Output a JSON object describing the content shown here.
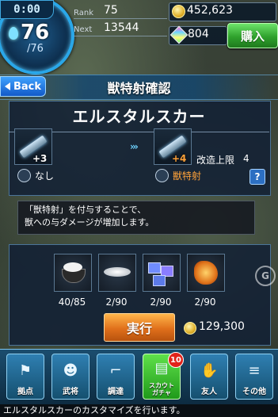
{
  "hud": {
    "timer": "0:00",
    "stamina_current": "76",
    "stamina_max": "/76",
    "rank_label": "Rank",
    "rank_value": "75",
    "next_label": "Next",
    "next_value": "13544",
    "coins": "452,623",
    "gems": "804",
    "buy_label": "購入"
  },
  "header": {
    "back_label": "Back",
    "title": "獣特射確認"
  },
  "weapon": {
    "name": "エルスタルスカー",
    "before_plus": "+3",
    "after_plus": "+4",
    "before_skill": "なし",
    "after_skill": "獣特射",
    "upgrade_limit_label": "改造上限",
    "upgrade_limit_value": "4",
    "help_label": "?"
  },
  "description": {
    "line1": "「獣特射」を付与することで、",
    "line2": "獣への与ダメージが増加します。"
  },
  "materials": [
    {
      "name": "white-powder-bowl",
      "count": "40/85"
    },
    {
      "name": "silver-disc",
      "count": "2/90"
    },
    {
      "name": "blue-cubes",
      "count": "2/90"
    },
    {
      "name": "orange-crystal-coral",
      "count": "2/90"
    }
  ],
  "action": {
    "execute_label": "実行",
    "cost": "129,300"
  },
  "nav": {
    "base": "拠点",
    "generals": "武将",
    "procure": "調達",
    "gacha_line1": "スカウト",
    "gacha_line2": "ガチャ",
    "gacha_badge": "10",
    "friends": "友人",
    "other": "その他"
  },
  "status": "エルスタルスカーのカスタマイズを行います。",
  "watermark": "G",
  "colors": {
    "accent_blue": "#2aa7e8",
    "buy_green": "#2fa12c",
    "execute_orange": "#e0701b",
    "skill_orange": "#ffa23a"
  }
}
